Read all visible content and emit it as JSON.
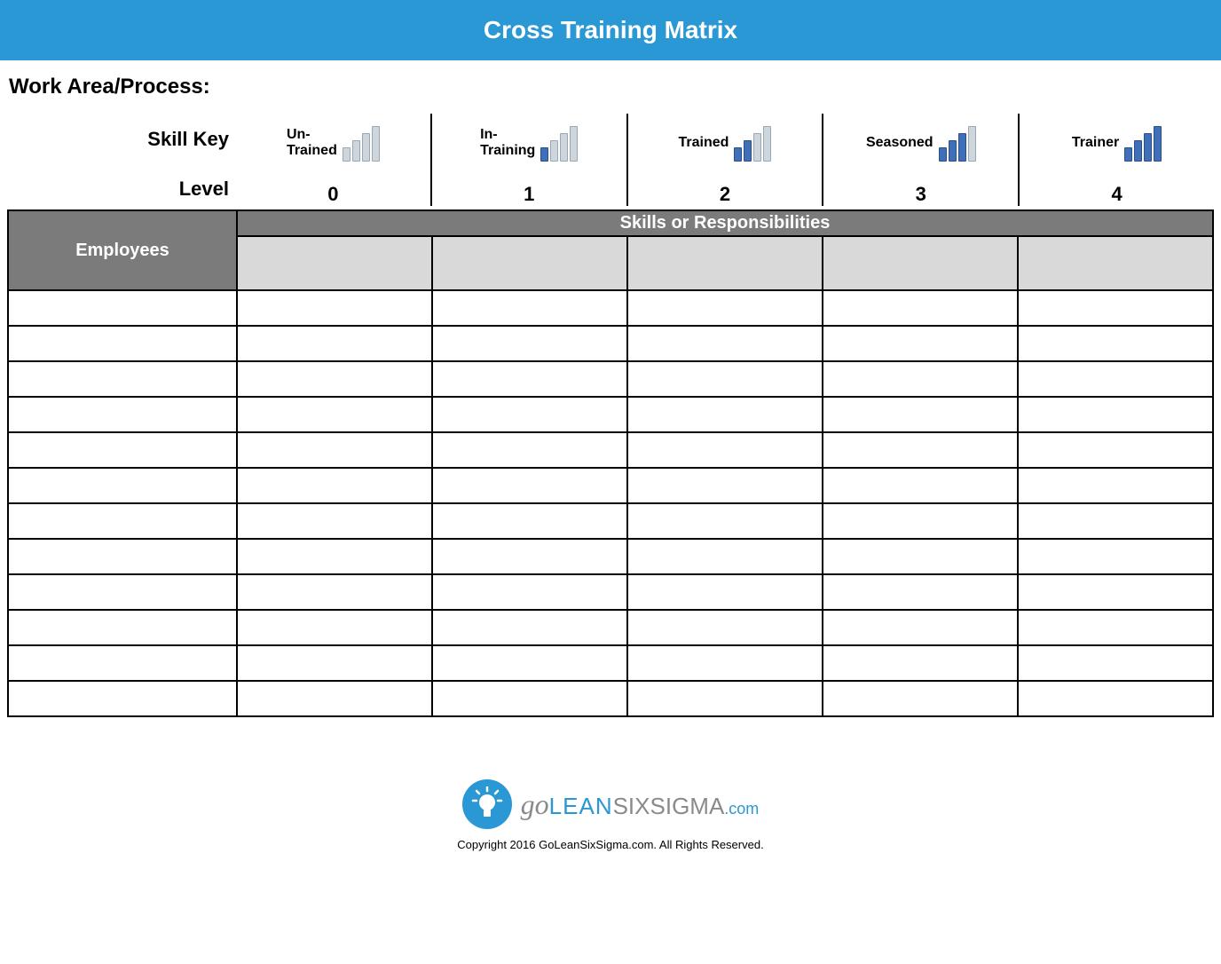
{
  "header": {
    "title": "Cross Training Matrix"
  },
  "work_area_label": "Work Area/Process:",
  "key": {
    "skill_key_label": "Skill Key",
    "level_label": "Level",
    "items": [
      {
        "label_line1": "Un-",
        "label_line2": "Trained",
        "level": "0",
        "filled": 0
      },
      {
        "label_line1": "In-",
        "label_line2": "Training",
        "level": "1",
        "filled": 1
      },
      {
        "label_line1": "Trained",
        "label_line2": "",
        "level": "2",
        "filled": 2
      },
      {
        "label_line1": "Seasoned",
        "label_line2": "",
        "level": "3",
        "filled": 3
      },
      {
        "label_line1": "Trainer",
        "label_line2": "",
        "level": "4",
        "filled": 4
      }
    ]
  },
  "matrix": {
    "employees_header": "Employees",
    "skills_header": "Skills or Responsibilities",
    "skill_columns": 5,
    "employee_rows": 12
  },
  "footer": {
    "brand_go": "go",
    "brand_lean": "LEAN",
    "brand_six": "SIXSIGMA",
    "brand_dotcom": ".com",
    "copyright": "Copyright 2016 GoLeanSixSigma.com. All Rights Reserved."
  },
  "colors": {
    "accent": "#2a98d4",
    "grey_header": "#7b7b7b",
    "grey_cell": "#d9d9d9"
  }
}
